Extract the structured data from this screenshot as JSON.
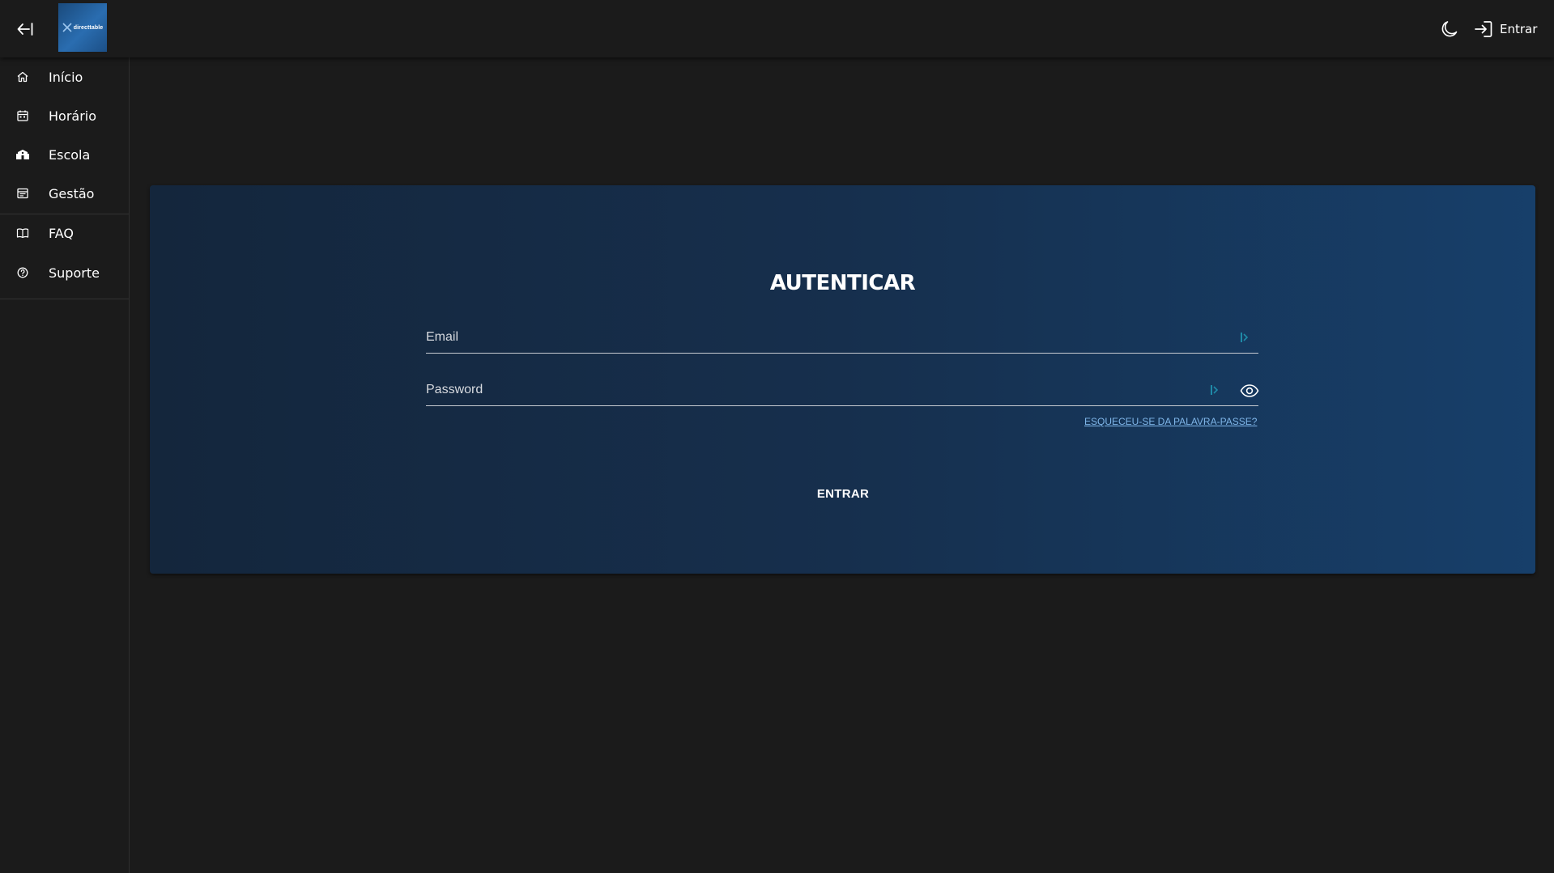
{
  "topbar": {
    "logo_text": "directtable",
    "login_label": "Entrar"
  },
  "sidebar": {
    "items": [
      {
        "label": "Início",
        "icon": "home-icon"
      },
      {
        "label": "Horário",
        "icon": "calendar-icon"
      },
      {
        "label": "Escola",
        "icon": "school-icon"
      },
      {
        "label": "Gestão",
        "icon": "management-icon"
      },
      {
        "label": "FAQ",
        "icon": "book-icon"
      },
      {
        "label": "Suporte",
        "icon": "help-circle-icon"
      }
    ]
  },
  "login": {
    "title": "AUTENTICAR",
    "email_placeholder": "Email",
    "password_placeholder": "Password",
    "forgot_label": "ESQUECEU-SE DA PALAVRA-PASSE?",
    "submit_label": "ENTRAR"
  },
  "colors": {
    "background": "#1b1b1b",
    "card_gradient_start": "#14263c",
    "card_gradient_end": "#173f6a",
    "link": "#7fb6e9",
    "password_manager_icon": "#1f8aa8"
  }
}
